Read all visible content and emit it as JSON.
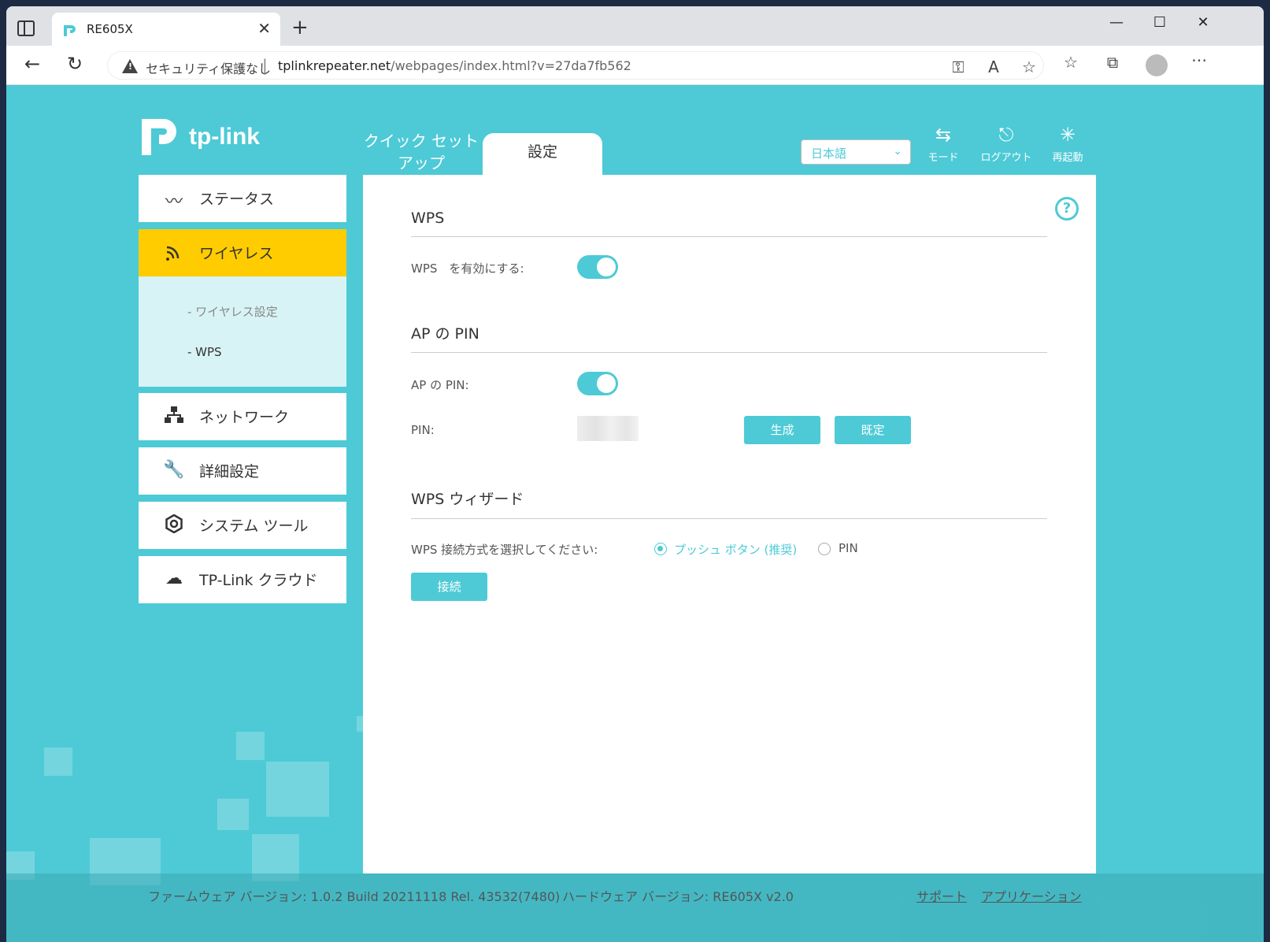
{
  "browser": {
    "tab_title": "RE605X",
    "security_text": "セキュリティ保護なし",
    "url_host": "tplinkrepeater.net",
    "url_rest": "/webpages/index.html?v=27da7fb562"
  },
  "header": {
    "logo": "tp-link",
    "tab_quick_line1": "クイック セット",
    "tab_quick_line2": "アップ",
    "tab_settings": "設定",
    "language": "日本語",
    "mode": "モード",
    "logout": "ログアウト",
    "reboot": "再起動"
  },
  "sidebar": {
    "items": [
      {
        "label": "ステータス",
        "icon": "status-icon"
      },
      {
        "label": "ワイヤレス",
        "icon": "wireless-icon"
      },
      {
        "label": "ネットワーク",
        "icon": "network-icon"
      },
      {
        "label": "詳細設定",
        "icon": "advanced-icon"
      },
      {
        "label": "システム ツール",
        "icon": "gear-icon"
      },
      {
        "label": "TP-Link クラウド",
        "icon": "cloud-icon"
      }
    ],
    "sub_items": [
      {
        "label": "- ワイヤレス設定"
      },
      {
        "label": "- WPS"
      }
    ]
  },
  "content": {
    "wps_title": "WPS",
    "wps_enable_label": "WPS　を有効にする:",
    "ap_pin_title": "AP の PIN",
    "ap_pin_label": "AP の PIN:",
    "pin_label": "PIN:",
    "generate_btn": "生成",
    "default_btn": "既定",
    "wizard_title": "WPS ウィザード",
    "method_label": "WPS 接続方式を選択してください:",
    "option_push": "プッシュ ボタン (推奨)",
    "option_pin": "PIN",
    "connect_btn": "接続"
  },
  "footer": {
    "firmware": "ファームウェア バージョン: 1.0.2 Build 20211118 Rel. 43532(7480)",
    "hardware": "ハードウェア バージョン: RE605X v2.0",
    "support": "サポート",
    "app": "アプリケーション"
  },
  "colors": {
    "accent": "#4dcad6",
    "active_menu": "#ffcc00"
  }
}
